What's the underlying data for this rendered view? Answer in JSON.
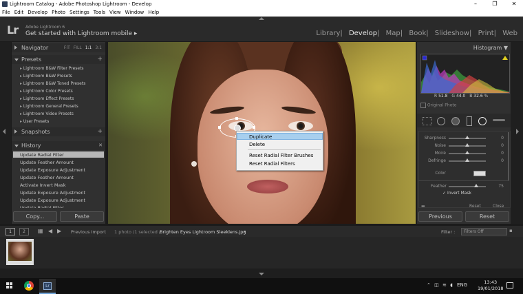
{
  "window": {
    "title": "Lightroom Catalog - Adobe Photoshop Lightroom - Develop",
    "controls": {
      "minimize": "–",
      "maximize": "❐",
      "close": "✕"
    }
  },
  "menu": [
    "File",
    "Edit",
    "Develop",
    "Photo",
    "Settings",
    "Tools",
    "View",
    "Window",
    "Help"
  ],
  "header": {
    "logo": "Lr",
    "version": "Adobe Lightroom 6",
    "mobile": "Get started with Lightroom mobile ▸",
    "modules": [
      "Library",
      "Develop",
      "Map",
      "Book",
      "Slideshow",
      "Print",
      "Web"
    ],
    "active_module": "Develop"
  },
  "left": {
    "navigator": {
      "title": "Navigator",
      "zoom": [
        "FIT",
        "FILL",
        "1:1",
        "3:1"
      ]
    },
    "presets": {
      "title": "Presets",
      "items": [
        "Lightroom B&W Filter Presets",
        "Lightroom B&W Presets",
        "Lightroom B&W Toned Presets",
        "Lightroom Color Presets",
        "Lightroom Effect Presets",
        "Lightroom General Presets",
        "Lightroom Video Presets",
        "User Presets"
      ]
    },
    "snapshots": {
      "title": "Snapshots"
    },
    "history": {
      "title": "History",
      "items": [
        "Update Radial Filter",
        "Update Feather Amount",
        "Update Exposure Adjustment",
        "Update Feather Amount",
        "Activate Invert Mask",
        "Update Exposure Adjustment",
        "Update Exposure Adjustment",
        "Update Radial Filter"
      ]
    },
    "copy": "Copy...",
    "paste": "Paste",
    "plus": "+",
    "close": "✕"
  },
  "context_menu": {
    "items": [
      "Duplicate",
      "Delete",
      "Reset Radial Filter Brushes",
      "Reset Radial Filters"
    ],
    "highlighted": "Duplicate"
  },
  "right": {
    "histogram": {
      "title": "Histogram ▼",
      "r": "51.8",
      "g": "44.0",
      "b": "32.6",
      "pct": "%",
      "labels": {
        "r": "R",
        "g": "G",
        "b": "B"
      }
    },
    "original_photo": "Original Photo",
    "sliders": [
      {
        "name": "Sharpness",
        "value": "0",
        "pos": 0.5
      },
      {
        "name": "Noise",
        "value": "0",
        "pos": 0.5
      },
      {
        "name": "Moiré",
        "value": "0",
        "pos": 0.5
      },
      {
        "name": "Defringe",
        "value": "0",
        "pos": 0.5
      }
    ],
    "color_label": "Color",
    "feather": {
      "name": "Feather",
      "value": "75",
      "pos": 0.75
    },
    "invert_mask": "Invert Mask",
    "reset": "Reset",
    "close": "Close",
    "previous": "Previous",
    "reset_button": "Reset"
  },
  "filmbar": {
    "views": [
      "1",
      "2"
    ],
    "previous_import": "Previous Import",
    "info": "1 photo /1 selected /",
    "filename": "Brighten Eyes Lightroom Sleeklens.jpg",
    "filter_label": "Filter :",
    "filter_value": "Filters Off"
  },
  "taskbar": {
    "tray": "ENG",
    "time": "13:43",
    "date": "19/01/2018"
  }
}
